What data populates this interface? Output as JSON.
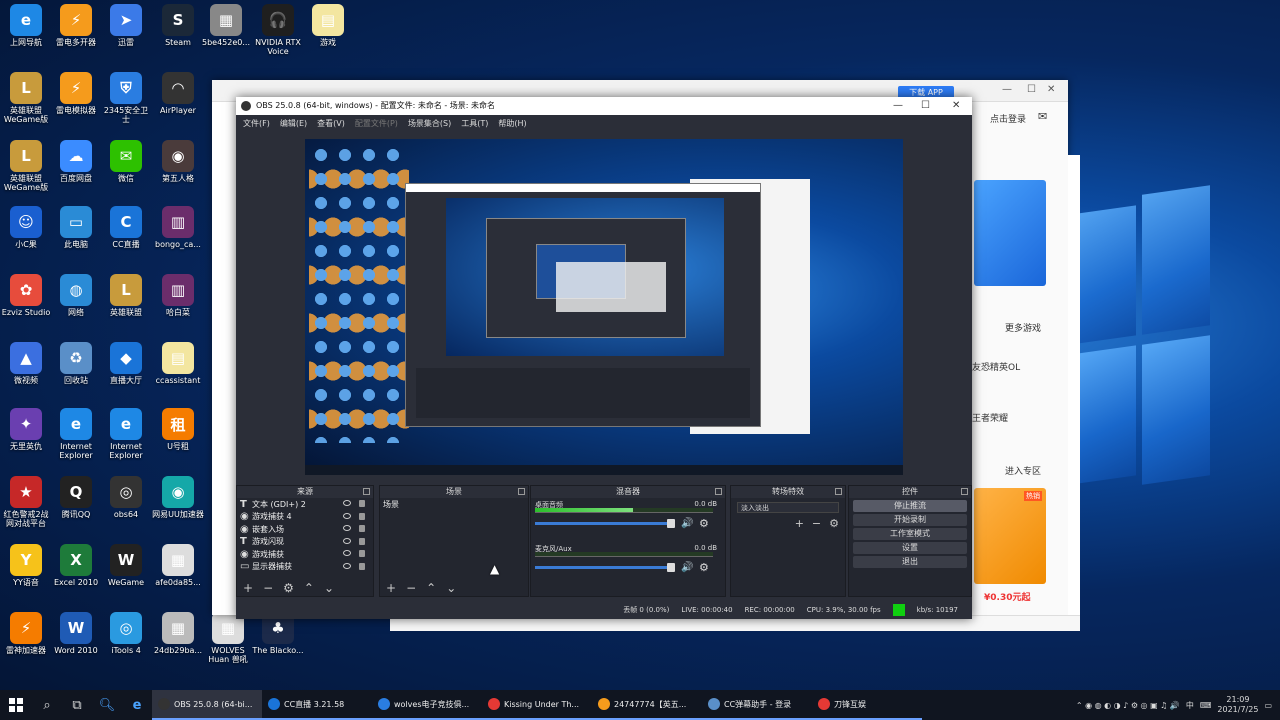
{
  "desktop": {
    "icons": [
      {
        "label": "上网导航",
        "color": "#1e88e5",
        "glyph": "e"
      },
      {
        "label": "雷电多开器",
        "color": "#f59b1c",
        "glyph": "⚡"
      },
      {
        "label": "迅雷",
        "color": "#3b7ae8",
        "glyph": "➤"
      },
      {
        "label": "Steam",
        "color": "#1b2838",
        "glyph": "S"
      },
      {
        "label": "5be452e0...",
        "color": "#888888",
        "glyph": "▦"
      },
      {
        "label": "NVIDIA RTX Voice",
        "color": "#1f1f1f",
        "glyph": "🎧"
      },
      {
        "label": "游戏",
        "color": "#f3e6a0",
        "glyph": "▤"
      },
      {
        "label": "英雄联盟 WeGame版",
        "color": "#c89b3c",
        "glyph": "L"
      },
      {
        "label": "雷电模拟器",
        "color": "#f59b1c",
        "glyph": "⚡"
      },
      {
        "label": "2345安全卫士",
        "color": "#2a7de1",
        "glyph": "⛨"
      },
      {
        "label": "AirPlayer",
        "color": "#333333",
        "glyph": "◠"
      },
      {
        "label": "英雄联盟 WeGame版",
        "color": "#c89b3c",
        "glyph": "L"
      },
      {
        "label": "百度网盘",
        "color": "#3b8cff",
        "glyph": "☁"
      },
      {
        "label": "微信",
        "color": "#2dc100",
        "glyph": "✉"
      },
      {
        "label": "第五人格",
        "color": "#4a3b3b",
        "glyph": "◉"
      },
      {
        "label": "小C果",
        "color": "#1a5fd0",
        "glyph": "☺"
      },
      {
        "label": "此电脑",
        "color": "#2a8bd6",
        "glyph": "▭"
      },
      {
        "label": "CC直播",
        "color": "#1a74d8",
        "glyph": "C"
      },
      {
        "label": "bongo_ca...",
        "color": "#6b2d6b",
        "glyph": "▥"
      },
      {
        "label": "Ezviz Studio",
        "color": "#e74c3c",
        "glyph": "✿"
      },
      {
        "label": "网络",
        "color": "#2a8bd6",
        "glyph": "◍"
      },
      {
        "label": "英雄联盟",
        "color": "#c89b3c",
        "glyph": "L"
      },
      {
        "label": "哈白菜",
        "color": "#6b2d6b",
        "glyph": "▥"
      },
      {
        "label": "微视频",
        "color": "#3b6fe0",
        "glyph": "▲"
      },
      {
        "label": "回收站",
        "color": "#5a8fc8",
        "glyph": "♻"
      },
      {
        "label": "直播大厅",
        "color": "#1a74d8",
        "glyph": "◆"
      },
      {
        "label": "ccassistant",
        "color": "#f3e6a0",
        "glyph": "▤"
      },
      {
        "label": "无里英仇",
        "color": "#6a3fb0",
        "glyph": "✦"
      },
      {
        "label": "Internet Explorer",
        "color": "#1e88e5",
        "glyph": "e"
      },
      {
        "label": "Internet Explorer",
        "color": "#1e88e5",
        "glyph": "e"
      },
      {
        "label": "U号租",
        "color": "#f57c00",
        "glyph": "租"
      },
      {
        "label": "红色警戒2战网对战平台",
        "color": "#c62828",
        "glyph": "★"
      },
      {
        "label": "腾讯QQ",
        "color": "#222222",
        "glyph": "Q"
      },
      {
        "label": "obs64",
        "color": "#333333",
        "glyph": "◎"
      },
      {
        "label": "网易UU加速器",
        "color": "#15a8a8",
        "glyph": "◉"
      },
      {
        "label": "YY语音",
        "color": "#f6c21a",
        "glyph": "Y"
      },
      {
        "label": "Excel 2010",
        "color": "#1e7b3a",
        "glyph": "X"
      },
      {
        "label": "WeGame",
        "color": "#222222",
        "glyph": "W"
      },
      {
        "label": "afe0da85...",
        "color": "#dddddd",
        "glyph": "▦"
      },
      {
        "label": "雷神加速器",
        "color": "#f57c00",
        "glyph": "⚡"
      },
      {
        "label": "Word 2010",
        "color": "#1f5bb5",
        "glyph": "W"
      },
      {
        "label": "iTools 4",
        "color": "#2a9ae0",
        "glyph": "◎"
      },
      {
        "label": "24db29ba...",
        "color": "#bbbbbb",
        "glyph": "▦"
      },
      {
        "label": "WOLVES Huan 兽吼",
        "color": "#dddddd",
        "glyph": "▦"
      },
      {
        "label": "The Blacko...",
        "color": "#1c2a4a",
        "glyph": "♣"
      }
    ]
  },
  "browser": {
    "download_app": "下载 APP",
    "login": "点击登录",
    "more_games": "更多游戏",
    "game1": "友恐精英OL",
    "game2": "王者荣耀",
    "enter_rank": "进入专区",
    "price": "¥0.30元起",
    "badge": "热销"
  },
  "obs": {
    "title": "OBS 25.0.8 (64-bit, windows) - 配置文件: 未命名 - 场景: 未命名",
    "menu": {
      "file": "文件(F)",
      "edit": "编辑(E)",
      "view": "查看(V)",
      "profile": "配置文件(P)",
      "scene_collection": "场景集合(S)",
      "tools": "工具(T)",
      "help": "帮助(H)"
    },
    "docks": {
      "sources": "来源",
      "scenes": "场景",
      "mixer": "混音器",
      "transitions": "转场特效",
      "controls": "控件"
    },
    "sources": [
      {
        "type": "T",
        "name": "文本 (GDI+) 2"
      },
      {
        "type": "eye",
        "name": "游戏捕获 4"
      },
      {
        "type": "eye",
        "name": "嵌套入场"
      },
      {
        "type": "T",
        "name": "游戏闪现"
      },
      {
        "type": "eye",
        "name": "游戏捕获"
      },
      {
        "type": "monitor",
        "name": "显示器捕获"
      }
    ],
    "scenes": [
      "场景"
    ],
    "mixer": [
      {
        "name": "桌面音频",
        "db": "0.0 dB",
        "level": 0.55
      },
      {
        "name": "麦克风/Aux",
        "db": "0.0 dB",
        "level": 0.0
      }
    ],
    "transition": "淡入淡出",
    "controls": {
      "stop_stream": "停止推流",
      "start_record": "开始录制",
      "studio_mode": "工作室模式",
      "settings": "设置",
      "exit": "退出"
    },
    "status": {
      "dropped": "丢帧 0 (0.0%)",
      "live": "LIVE: 00:00:40",
      "rec": "REC: 00:00:00",
      "cpu": "CPU: 3.9%, 30.00 fps",
      "kbps": "kb/s: 10197"
    }
  },
  "taskbar": {
    "tasks": [
      {
        "label": "OBS 25.0.8 (64-bi...",
        "color": "#333333",
        "active": true
      },
      {
        "label": "CC直播 3.21.58",
        "color": "#1a74d8",
        "active": false
      },
      {
        "label": "wolves电子竞技俱...",
        "color": "#2a7de1",
        "active": false
      },
      {
        "label": "Kissing Under Th...",
        "color": "#e53935",
        "active": false
      },
      {
        "label": "24747774【英五...",
        "color": "#f59b1c",
        "active": false
      },
      {
        "label": "CC弹幕助手 - 登录",
        "color": "#5a8fc8",
        "active": false
      },
      {
        "label": "刀锋互娱",
        "color": "#e53935",
        "active": false
      }
    ],
    "ime": "中",
    "time": "21:09",
    "date": "2021/7/25"
  }
}
